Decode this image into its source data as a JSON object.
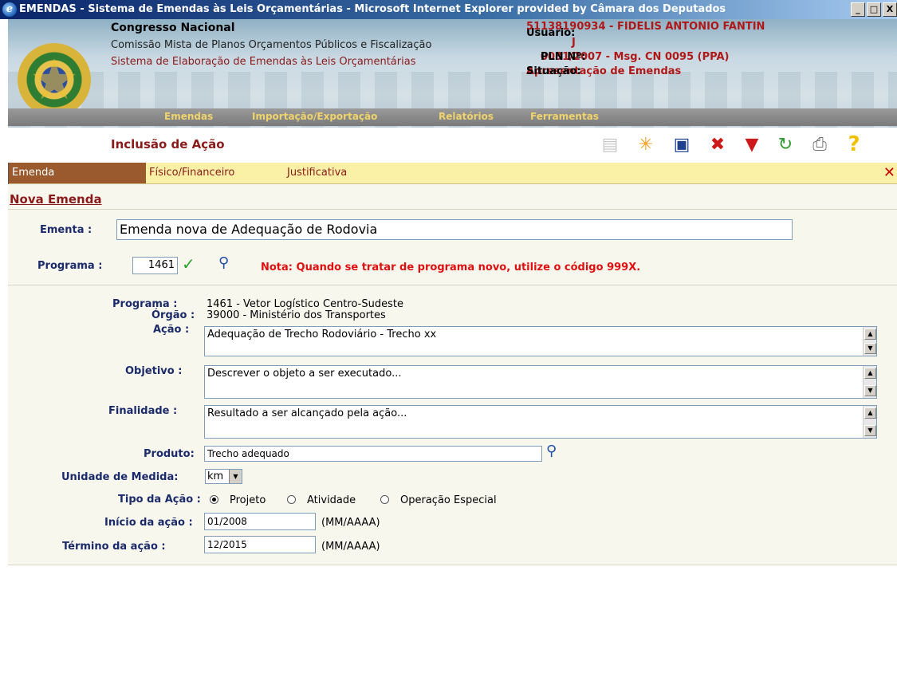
{
  "window": {
    "title": "EMENDAS - Sistema de Emendas às Leis Orçamentárias - Microsoft Internet Explorer provided by Câmara dos Deputados",
    "controls": [
      "_",
      "□",
      "X"
    ]
  },
  "header": {
    "org_name": "Congresso Nacional",
    "committee": "Comissão Mista de Planos Orçamentos Públicos e Fiscalização",
    "system": "Sistema de Elaboração de Emendas às Leis Orçamentárias",
    "user_label": "Usuário:",
    "user_value": "51138190934 - FIDELIS ANTONIO FANTIN",
    "user_value_cont": "J",
    "pln_label": "PLN Nº:",
    "pln_value": "0031/2007 - Msg. CN 0095 (PPA)",
    "situacao_label": "Situação:",
    "situacao_value": "Apresentação de Emendas"
  },
  "menu": [
    "Emendas",
    "Importação/Exportação",
    "Relatórios",
    "Ferramentas"
  ],
  "page_heading": "Inclusão de Ação",
  "toolbar_icons": [
    "document-icon",
    "new-icon",
    "save-icon",
    "delete-icon",
    "filter-icon",
    "refresh-icon",
    "print-icon",
    "help-icon"
  ],
  "tabs": [
    "Emenda",
    "Físico/Financeiro",
    "Justificativa"
  ],
  "tab_close": "✕",
  "form": {
    "section_title": "Nova Emenda",
    "ementa_label": "Ementa :",
    "ementa_value": "Emenda nova de Adequação de Rodovia",
    "programa_label": "Programa :",
    "programa_value": "1461",
    "note": "Nota: Quando se tratar de programa novo, utilize o código 999X.",
    "info_programa_label": "Programa :",
    "info_programa_value": "1461 - Vetor Logístico Centro-Sudeste",
    "info_orgao_label": "Órgão :",
    "info_orgao_value": "39000 - Ministério dos Transportes",
    "acao_label": "Ação :",
    "acao_value": "Adequação de Trecho Rodoviário - Trecho xx",
    "objetivo_label": "Objetivo :",
    "objetivo_value": "Descrever o objeto a ser executado...",
    "finalidade_label": "Finalidade :",
    "finalidade_value": "Resultado a ser alcançado pela ação...",
    "produto_label": "Produto:",
    "produto_value": "Trecho adequado",
    "unidade_label": "Unidade de Medida:",
    "unidade_value": "km",
    "tipo_label": "Tipo da Ação :",
    "tipo_options": [
      "Projeto",
      "Atividade",
      "Operação Especial"
    ],
    "tipo_selected": "Projeto",
    "inicio_label": "Início da ação :",
    "inicio_value": "01/2008",
    "inicio_hint": "(MM/AAAA)",
    "termino_label": "Término da ação :",
    "termino_value": "12/2015",
    "termino_hint": "(MM/AAAA)"
  }
}
